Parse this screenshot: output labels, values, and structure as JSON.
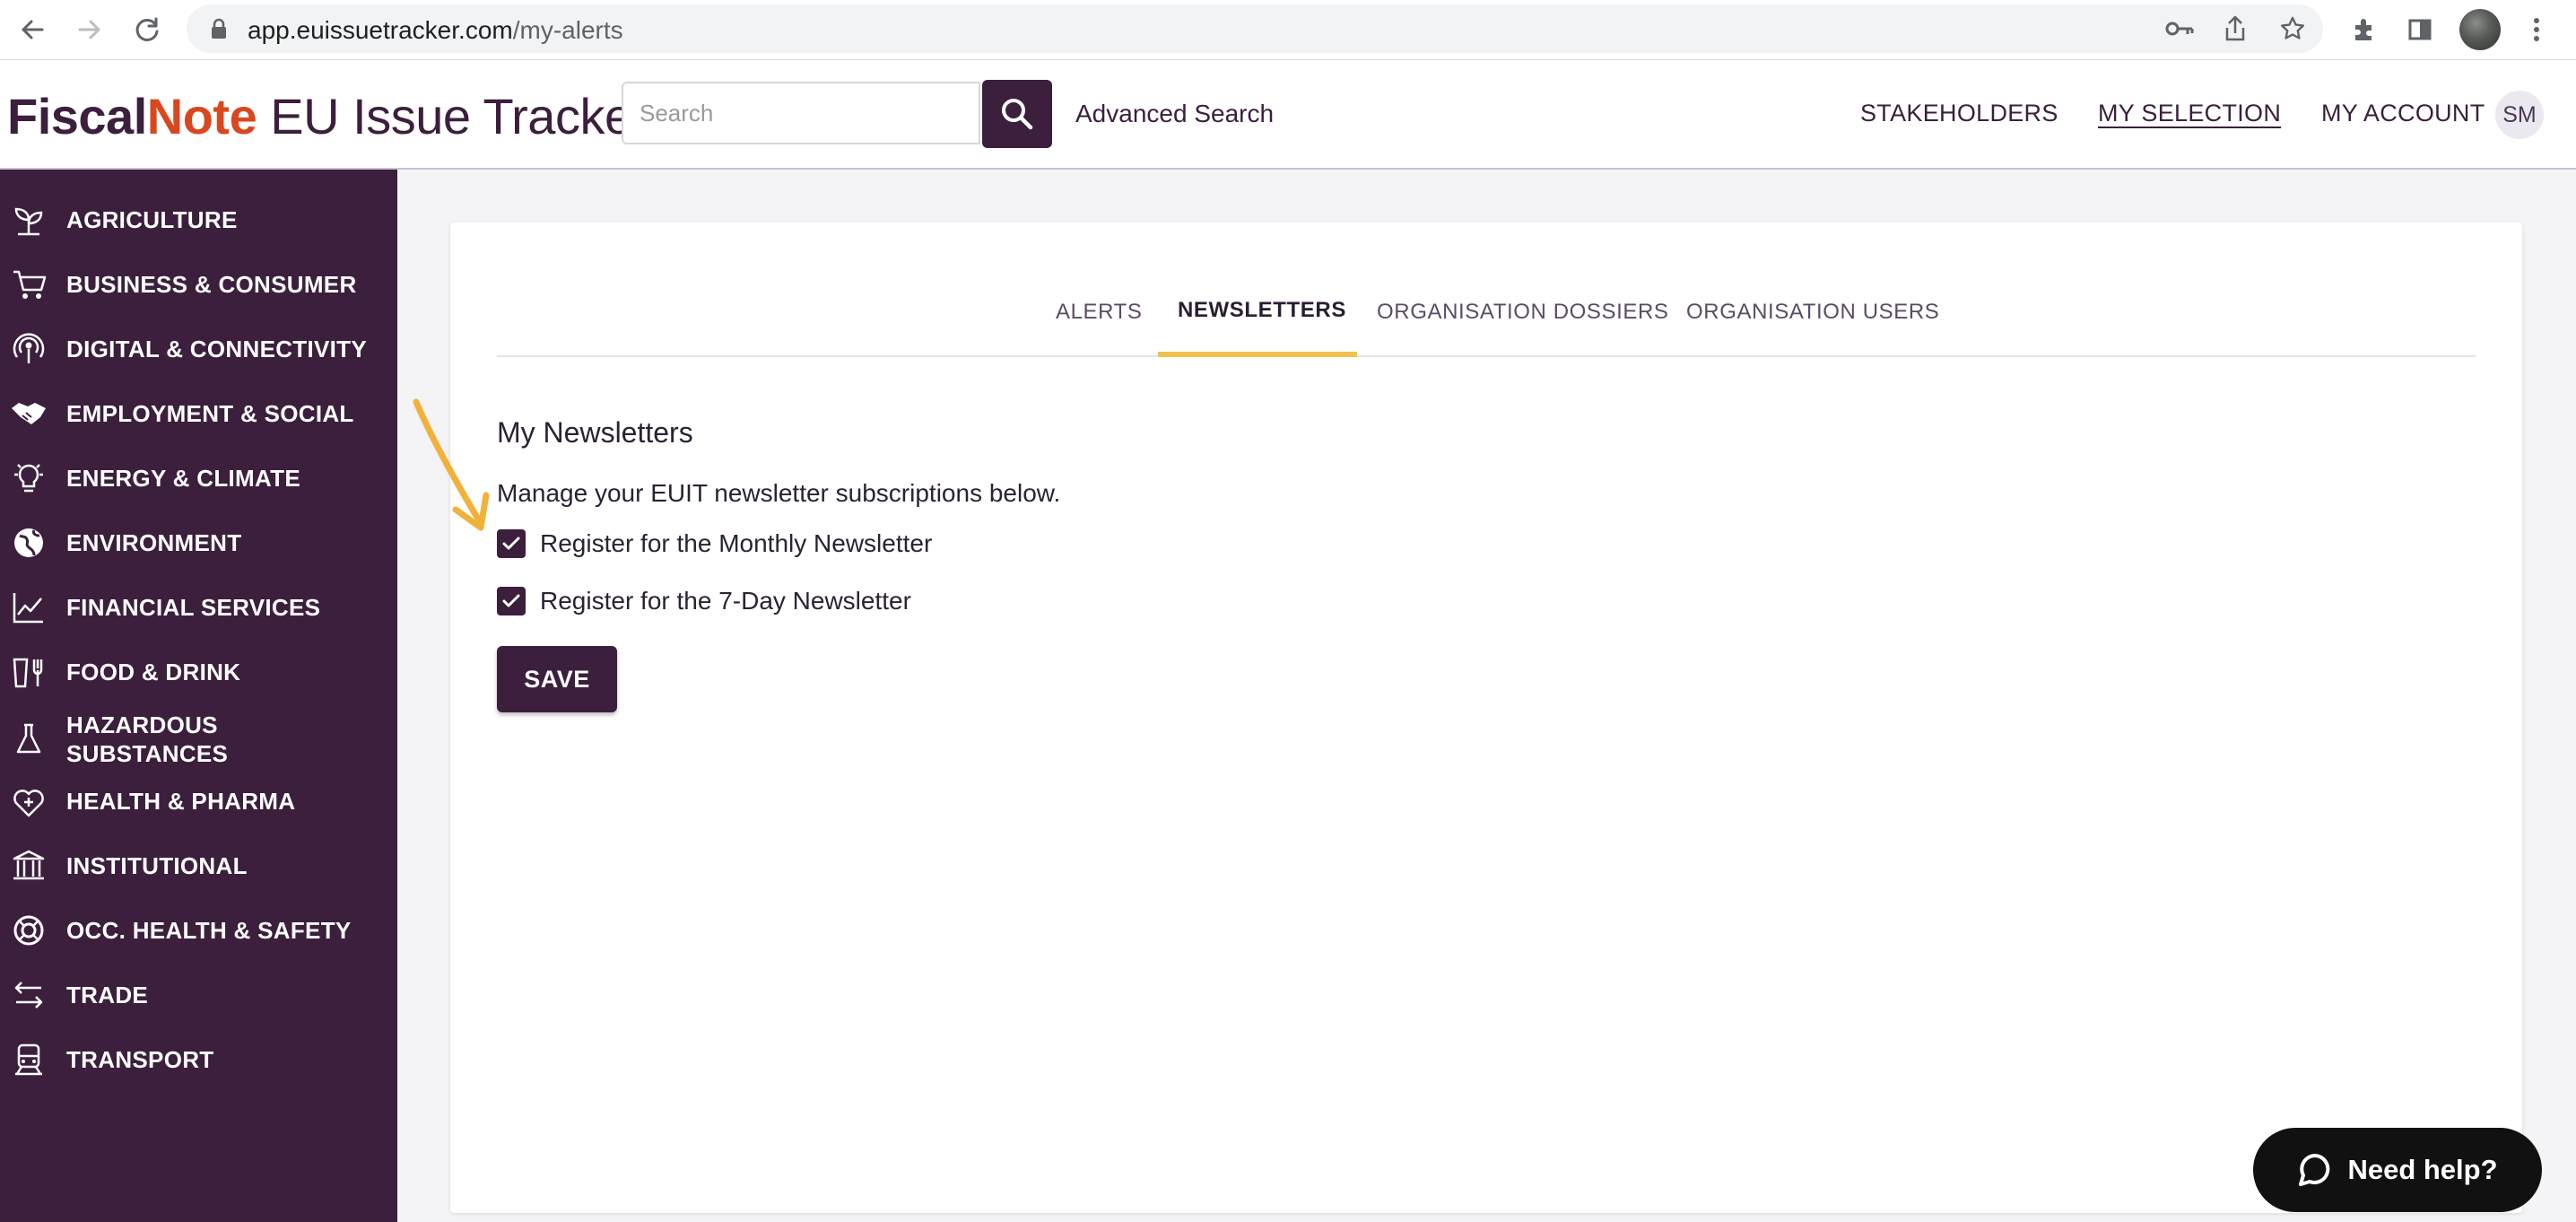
{
  "browser": {
    "url_host": "app.euissuetracker.com",
    "url_path": "/my-alerts"
  },
  "header": {
    "logo_fiscal": "Fiscal",
    "logo_note": "Note",
    "logo_rest": " EU Issue Tracker",
    "search_placeholder": "Search",
    "advanced_search": "Advanced Search",
    "nav": [
      "STAKEHOLDERS",
      "MY SELECTION",
      "MY ACCOUNT"
    ],
    "avatar_initials": "SM"
  },
  "sidebar": {
    "items": [
      {
        "label": "AGRICULTURE",
        "icon": "sprout-icon"
      },
      {
        "label": "BUSINESS & CONSUMER",
        "icon": "cart-icon"
      },
      {
        "label": "DIGITAL & CONNECTIVITY",
        "icon": "broadcast-icon"
      },
      {
        "label": "EMPLOYMENT & SOCIAL",
        "icon": "handshake-icon"
      },
      {
        "label": "ENERGY & CLIMATE",
        "icon": "bulb-icon"
      },
      {
        "label": "ENVIRONMENT",
        "icon": "globe-icon"
      },
      {
        "label": "FINANCIAL SERVICES",
        "icon": "chart-icon"
      },
      {
        "label": "FOOD & DRINK",
        "icon": "cutlery-icon"
      },
      {
        "label": "HAZARDOUS SUBSTANCES",
        "icon": "flask-icon"
      },
      {
        "label": "HEALTH & PHARMA",
        "icon": "heart-plus-icon"
      },
      {
        "label": "INSTITUTIONAL",
        "icon": "building-icon"
      },
      {
        "label": "OCC. HEALTH & SAFETY",
        "icon": "lifebuoy-icon"
      },
      {
        "label": "TRADE",
        "icon": "exchange-icon"
      },
      {
        "label": "TRANSPORT",
        "icon": "train-icon"
      }
    ]
  },
  "tabs": [
    {
      "label": "ALERTS",
      "active": false
    },
    {
      "label": "NEWSLETTERS",
      "active": true
    },
    {
      "label": "ORGANISATION DOSSIERS",
      "active": false
    },
    {
      "label": "ORGANISATION USERS",
      "active": false
    }
  ],
  "content": {
    "title": "My Newsletters",
    "description": "Manage your EUIT newsletter subscriptions below.",
    "options": [
      {
        "label": "Register for the Monthly Newsletter",
        "checked": true
      },
      {
        "label": "Register for the 7-Day Newsletter",
        "checked": true
      }
    ],
    "save_label": "SAVE"
  },
  "help": {
    "label": "Need help?"
  },
  "colors": {
    "brand_purple": "#3b1f3d",
    "brand_orange": "#d9471f",
    "tab_ink": "#f2c14e",
    "annotation_arrow": "#f0b23a"
  }
}
